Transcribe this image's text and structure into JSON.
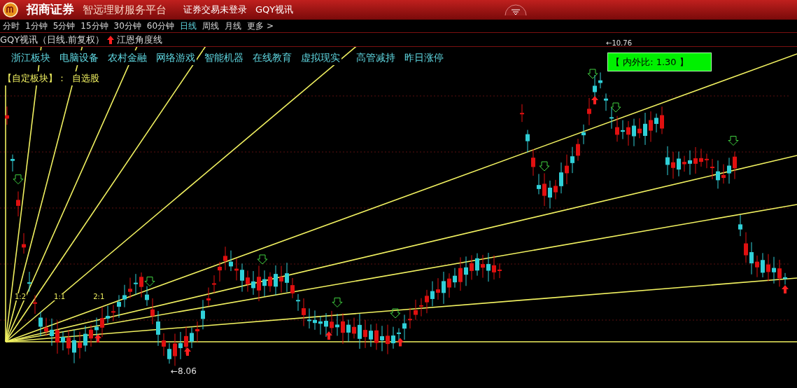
{
  "title_bar": {
    "brand": "招商证券",
    "platform": "智远理财服务平台",
    "login_status": "证券交易未登录",
    "stock": "GQY视讯"
  },
  "periods": [
    {
      "label": "分时",
      "selected": false
    },
    {
      "label": "1分钟",
      "selected": false
    },
    {
      "label": "5分钟",
      "selected": false
    },
    {
      "label": "15分钟",
      "selected": false
    },
    {
      "label": "30分钟",
      "selected": false
    },
    {
      "label": "60分钟",
      "selected": false
    },
    {
      "label": "日线",
      "selected": true
    },
    {
      "label": "周线",
      "selected": false
    },
    {
      "label": "月线",
      "selected": false
    },
    {
      "label": "更多 >",
      "selected": false
    }
  ],
  "chart": {
    "title": "GQY视讯（日线.前复权）",
    "indicator": "江恩角度线",
    "sectors": [
      "浙江板块",
      "电脑设备",
      "农村金融",
      "网络游戏",
      "智能机器",
      "在线教育",
      "虚拟现实",
      "高管减持",
      "昨日涨停"
    ],
    "custom_block_label": "【自定板块】：",
    "custom_block_value": "自选股",
    "ratio_box": "【 内外比: 1.30 】",
    "high_label": "←10.76",
    "low_label": "←8.06",
    "gann_labels": [
      "1:2",
      "1:1",
      "2:1"
    ]
  }
}
